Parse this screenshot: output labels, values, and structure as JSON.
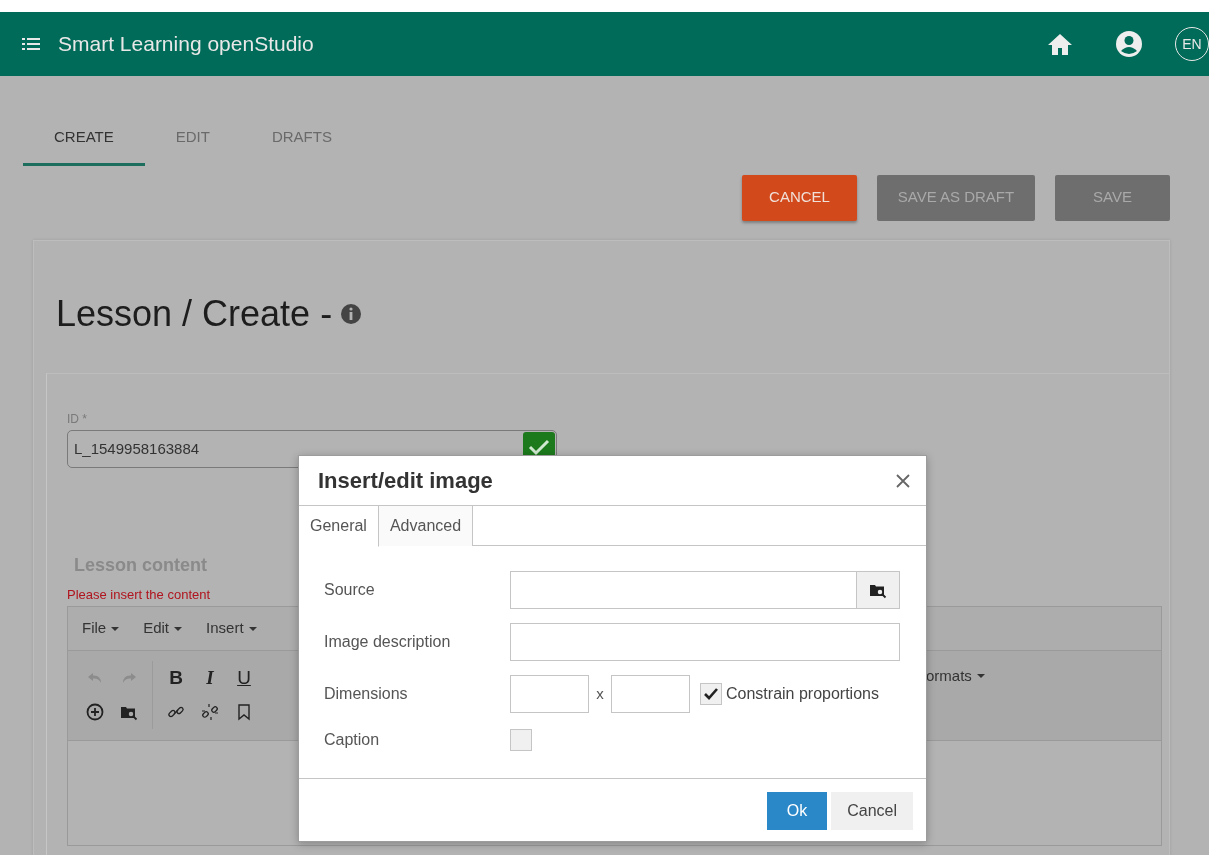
{
  "app_bar": {
    "title": "Smart Learning openStudio",
    "language": "EN"
  },
  "tabs": [
    {
      "label": "CREATE",
      "selected": true
    },
    {
      "label": "EDIT",
      "selected": false
    },
    {
      "label": "DRAFTS",
      "selected": false
    }
  ],
  "actions": [
    {
      "label": "CANCEL",
      "kind": "danger",
      "disabled": false
    },
    {
      "label": "SAVE AS DRAFT",
      "kind": "plain",
      "disabled": true
    },
    {
      "label": "SAVE",
      "kind": "plain",
      "disabled": true
    }
  ],
  "page_title": "Lesson / Create -",
  "id_field": {
    "label": "ID *",
    "value": "L_1549958163884",
    "valid": true
  },
  "content_section": {
    "title": "Lesson content",
    "error": "Please insert the content"
  },
  "editor": {
    "menus": [
      "File",
      "Edit",
      "Insert"
    ],
    "toolbar_row_1": [
      {
        "kind": "undo",
        "disabled": true
      },
      {
        "kind": "redo",
        "disabled": true
      },
      {
        "kind": "separator"
      },
      {
        "kind": "bold",
        "label": "B"
      },
      {
        "kind": "italic",
        "label": "I"
      },
      {
        "kind": "underline",
        "label": "U"
      }
    ],
    "toolbar_row_2": [
      {
        "kind": "add"
      },
      {
        "kind": "browse"
      },
      {
        "kind": "separator"
      },
      {
        "kind": "link"
      },
      {
        "kind": "unlink"
      },
      {
        "kind": "bookmark"
      }
    ],
    "formats_menu": "ormats"
  },
  "dialog": {
    "title": "Insert/edit image",
    "tabs": [
      {
        "label": "General",
        "selected": true
      },
      {
        "label": "Advanced",
        "selected": false
      }
    ],
    "source_label": "Source",
    "description_label": "Image description",
    "dimensions_label": "Dimensions",
    "dimensions_separator": "x",
    "constrain": {
      "label": "Constrain proportions",
      "checked": true
    },
    "caption": {
      "label": "Caption",
      "checked": false
    },
    "buttons": [
      {
        "label": "Ok",
        "kind": "primary"
      },
      {
        "label": "Cancel",
        "kind": "secondary"
      }
    ]
  }
}
